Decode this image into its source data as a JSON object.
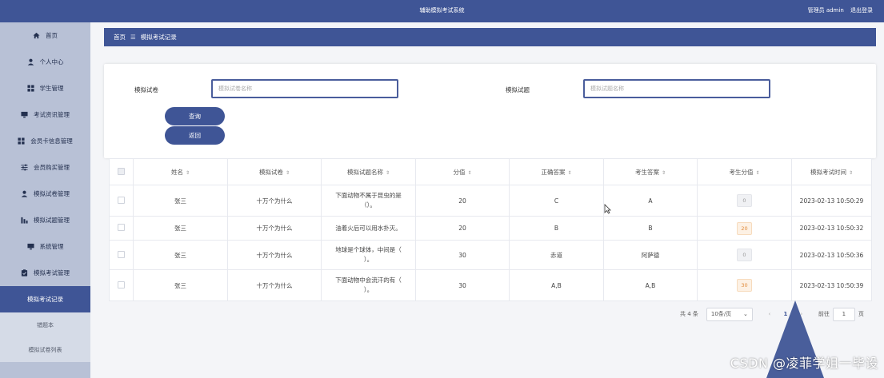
{
  "header": {
    "title": "辅助模拟考试系统",
    "user_label": "管理员 admin",
    "logout": "退出登录"
  },
  "sidebar": {
    "items": [
      {
        "label": "首页",
        "icon": "home-icon"
      },
      {
        "label": "个人中心",
        "icon": "user-icon"
      },
      {
        "label": "学生管理",
        "icon": "grid-icon"
      },
      {
        "label": "考试资讯管理",
        "icon": "monitor-icon"
      },
      {
        "label": "会员卡信息管理",
        "icon": "grid-icon"
      },
      {
        "label": "会员购买管理",
        "icon": "sliders-icon"
      },
      {
        "label": "模拟试卷管理",
        "icon": "user-icon"
      },
      {
        "label": "模拟试题管理",
        "icon": "chart-icon"
      },
      {
        "label": "系统管理",
        "icon": "monitor-icon"
      },
      {
        "label": "模拟考试管理",
        "icon": "clipboard-icon"
      }
    ],
    "subitems": [
      "模拟考试记录",
      "错题本",
      "模拟试卷列表"
    ]
  },
  "breadcrumb": {
    "home": "首页",
    "sep": "☰",
    "current": "模拟考试记录"
  },
  "search": {
    "paper_label": "模拟试卷",
    "paper_placeholder": "模拟试卷名称",
    "question_label": "模拟试题",
    "question_placeholder": "模拟试题名称",
    "query_button": "查询",
    "back_button": "返回"
  },
  "table": {
    "columns": [
      "姓名",
      "模拟试卷",
      "模拟试题名称",
      "分值",
      "正确答案",
      "考生答案",
      "考生分值",
      "模拟考试时间"
    ],
    "rows": [
      {
        "name": "张三",
        "paper": "十万个为什么",
        "question": "下面动物不属于昆虫的是（）。",
        "score": "20",
        "correct": "C",
        "answer": "A",
        "got": "0",
        "time": "2023-02-13 10:50:29"
      },
      {
        "name": "张三",
        "paper": "十万个为什么",
        "question": "油着火后可以用水扑灭。",
        "score": "20",
        "correct": "B",
        "answer": "B",
        "got": "20",
        "time": "2023-02-13 10:50:32"
      },
      {
        "name": "张三",
        "paper": "十万个为什么",
        "question": "地球是个球体，中间是（ ）。",
        "score": "30",
        "correct": "赤道",
        "answer": "阿萨德",
        "got": "0",
        "time": "2023-02-13 10:50:36"
      },
      {
        "name": "张三",
        "paper": "十万个为什么",
        "question": "下面动物中会流汗的有（ ）。",
        "score": "30",
        "correct": "A,B",
        "answer": "A,B",
        "got": "30",
        "time": "2023-02-13 10:50:39"
      }
    ]
  },
  "pagination": {
    "total": "共 4 条",
    "page_size": "10条/页",
    "current_page": "1",
    "goto_label": "前往",
    "goto_value": "1",
    "page_suffix": "页"
  },
  "watermark": "CSDN @凌菲学姐一毕设"
}
